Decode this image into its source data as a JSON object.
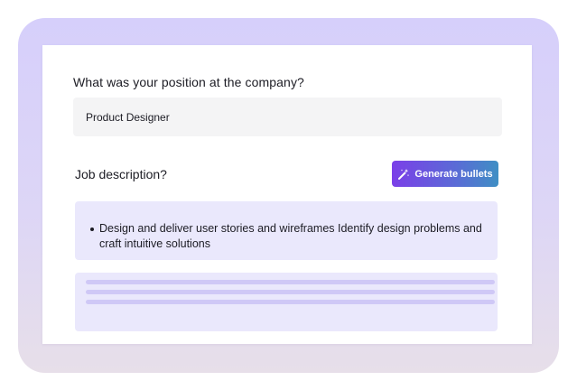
{
  "form": {
    "position_question": "What was your position at the company?",
    "position_value": "Product Designer",
    "job_description_label": "Job description?",
    "generate_button_label": "Generate bullets",
    "generate_button_icon": "magic-wand-icon",
    "bullets": [
      "Design and deliver user stories and wireframes Identify design problems and craft intuitive solutions"
    ]
  },
  "colors": {
    "frame_background": "#d6cffb",
    "card_background": "#ffffff",
    "field_background": "#f4f4f5",
    "bullet_box_background": "#eae8fc",
    "placeholder_line": "#cfc8f6",
    "button_gradient_start": "#7b3fe8",
    "button_gradient_end": "#3f8fc4"
  }
}
